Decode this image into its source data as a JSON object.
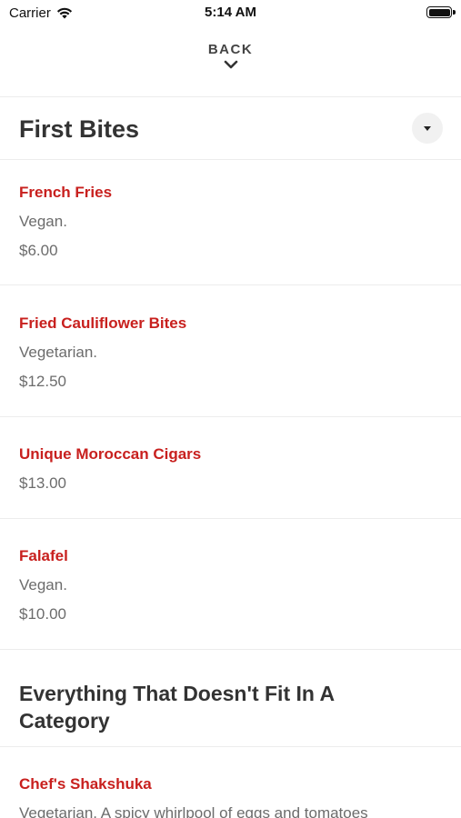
{
  "status_bar": {
    "carrier": "Carrier",
    "time": "5:14 AM",
    "battery_level": 1.0
  },
  "nav": {
    "back_label": "BACK",
    "chevron_icon": "chevron-down-icon"
  },
  "sections": [
    {
      "title": "First Bites",
      "collapse_icon": "caret-down-icon",
      "items": [
        {
          "name": "French Fries",
          "description": "Vegan.",
          "price": "$6.00"
        },
        {
          "name": "Fried Cauliflower Bites",
          "description": "Vegetarian.",
          "price": "$12.50"
        },
        {
          "name": "Unique Moroccan Cigars",
          "description": "",
          "price": "$13.00"
        },
        {
          "name": "Falafel",
          "description": "Vegan.",
          "price": "$10.00"
        }
      ]
    },
    {
      "title": "Everything That Doesn't Fit In A Category",
      "items": [
        {
          "name": "Chef's Shakshuka",
          "description": "Vegetarian. A spicy whirlpool of eggs and tomatoes"
        }
      ]
    }
  ],
  "colors": {
    "item_name": "#c8201e",
    "secondary_text": "#6c6c6c",
    "title_text": "#333333",
    "divider": "#ececec"
  }
}
